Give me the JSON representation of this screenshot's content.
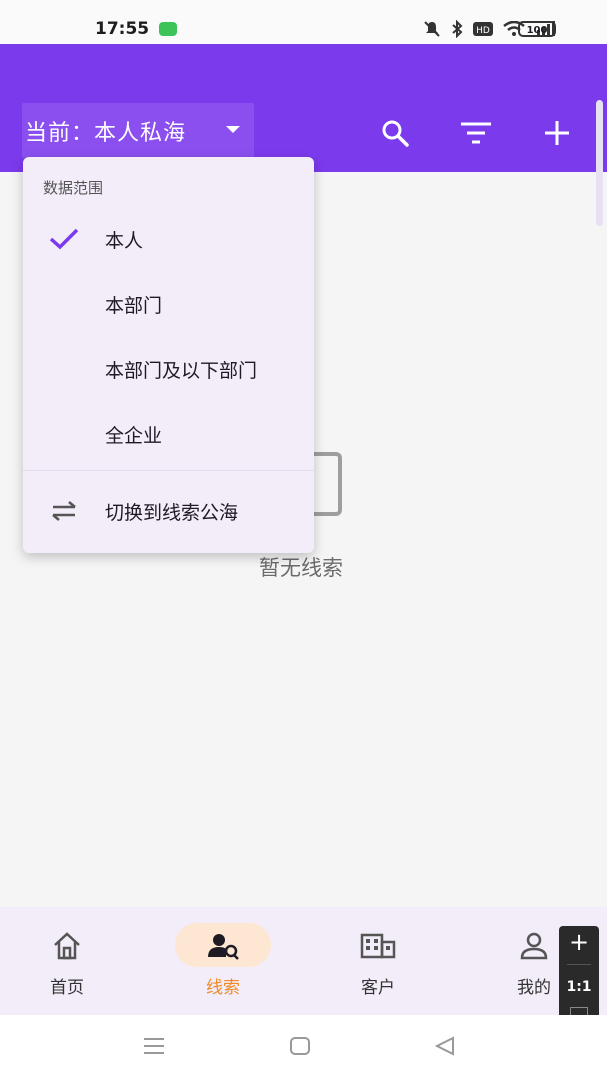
{
  "status_bar": {
    "time": "17:55",
    "battery": "100"
  },
  "header": {
    "scope_label": "当前：本人私海",
    "icons": [
      "search-icon",
      "filter-icon",
      "add-icon"
    ]
  },
  "dropdown": {
    "section_title": "数据范围",
    "options": [
      {
        "label": "本人",
        "selected": true
      },
      {
        "label": "本部门",
        "selected": false
      },
      {
        "label": "本部门及以下部门",
        "selected": false
      },
      {
        "label": "全企业",
        "selected": false
      }
    ],
    "switch_label": "切换到线索公海"
  },
  "empty_state": {
    "text": "暂无线索"
  },
  "bottom_nav": {
    "items": [
      {
        "label": "首页",
        "icon": "home-icon",
        "active": false
      },
      {
        "label": "线索",
        "icon": "leads-icon",
        "active": true
      },
      {
        "label": "客户",
        "icon": "building-icon",
        "active": false
      },
      {
        "label": "我的",
        "icon": "person-icon",
        "active": false
      }
    ],
    "active_color": "#f08a24"
  },
  "zoom_panel": {
    "ratio": "1:1"
  },
  "colors": {
    "primary": "#7c3aed",
    "check": "#7c3aed",
    "menu_bg": "#f3ecf9"
  }
}
